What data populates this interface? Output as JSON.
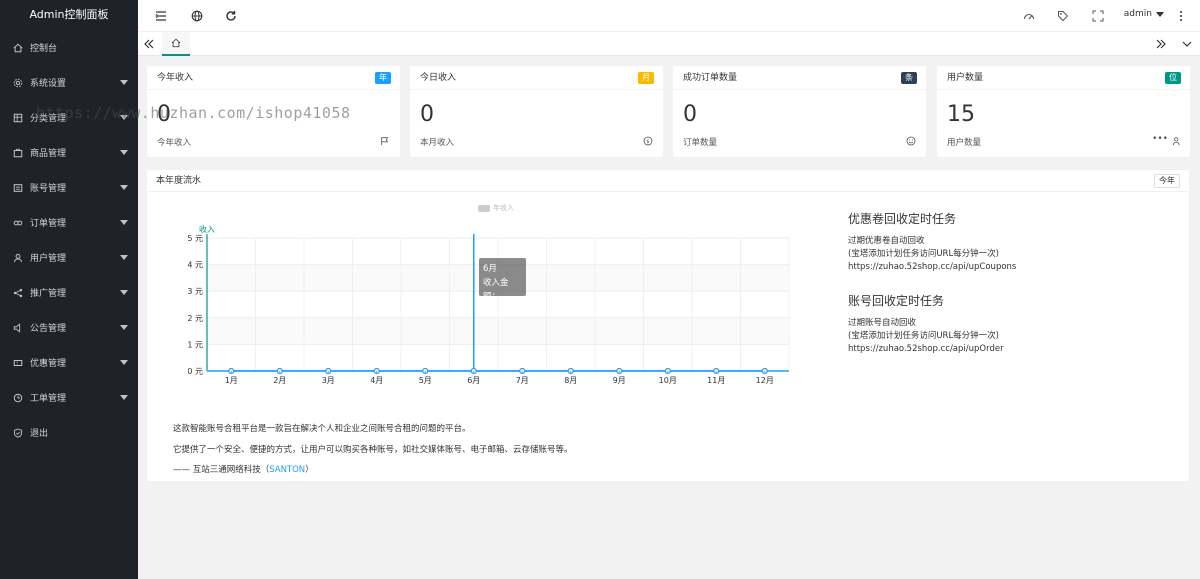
{
  "sidebar": {
    "title": "Admin控制面板",
    "items": [
      {
        "label": "控制台",
        "icon": "home-icon",
        "arrow": false
      },
      {
        "label": "系统设置",
        "icon": "gear-icon",
        "arrow": true
      },
      {
        "label": "分类管理",
        "icon": "category-icon",
        "arrow": true
      },
      {
        "label": "商品管理",
        "icon": "goods-icon",
        "arrow": true
      },
      {
        "label": "账号管理",
        "icon": "account-icon",
        "arrow": true
      },
      {
        "label": "订单管理",
        "icon": "link-icon",
        "arrow": true
      },
      {
        "label": "用户管理",
        "icon": "user-icon",
        "arrow": true
      },
      {
        "label": "推广管理",
        "icon": "share-icon",
        "arrow": true
      },
      {
        "label": "公告管理",
        "icon": "notice-icon",
        "arrow": true
      },
      {
        "label": "优惠管理",
        "icon": "coupon-icon",
        "arrow": true
      },
      {
        "label": "工单管理",
        "icon": "clock-icon",
        "arrow": true
      },
      {
        "label": "退出",
        "icon": "shield-icon",
        "arrow": false
      }
    ]
  },
  "header": {
    "user": "admin"
  },
  "cards": [
    {
      "title": "今年收入",
      "badge": "年",
      "badge_color": "#1e9fff",
      "value": "0",
      "sub": "今年收入",
      "icon": "flag-icon"
    },
    {
      "title": "今日收入",
      "badge": "月",
      "badge_color": "#ffb800",
      "value": "0",
      "sub": "本月收入",
      "icon": "dollar-icon"
    },
    {
      "title": "成功订单数量",
      "badge": "条",
      "badge_color": "#2f4056",
      "value": "0",
      "sub": "订单数量",
      "icon": "smile-icon"
    },
    {
      "title": "用户数量",
      "badge": "位",
      "badge_color": "#009688",
      "value": "15",
      "sub": "用户数量",
      "icon": "users-icon"
    }
  ],
  "panel": {
    "title": "本年度流水",
    "year_button": "今年"
  },
  "chart_data": {
    "type": "line",
    "categories": [
      "1月",
      "2月",
      "3月",
      "4月",
      "5月",
      "6月",
      "7月",
      "8月",
      "9月",
      "10月",
      "11月",
      "12月"
    ],
    "series": [
      {
        "name": "年收入",
        "values": [
          0,
          0,
          0,
          0,
          0,
          0,
          0,
          0,
          0,
          0,
          0,
          0
        ]
      }
    ],
    "ylabel": "收入",
    "yticks": [
      "0 元",
      "1 元",
      "2 元",
      "3 元",
      "4 元",
      "5 元"
    ],
    "ylim": [
      0,
      5
    ],
    "grid": true,
    "legend": "top-center",
    "tooltip": {
      "month": "6月",
      "label": "收入金额："
    },
    "highlight_index": 5,
    "color": "#1e9fff"
  },
  "tasks": [
    {
      "title": "优惠卷回收定时任务",
      "lines": [
        "过期优惠卷自动回收",
        "(宝塔添加计划任务访问URL每分钟一次)",
        "https://zuhao.52shop.cc/api/upCoupons"
      ]
    },
    {
      "title": "账号回收定时任务",
      "lines": [
        "过期账号自动回收",
        "(宝塔添加计划任务访问URL每分钟一次)",
        "https://zuhao.52shop.cc/api/upOrder"
      ]
    }
  ],
  "about": {
    "line1": "这款智能账号合租平台是一款旨在解决个人和企业之间账号合租的问题的平台。",
    "line2": "它提供了一个安全、便捷的方式，让用户可以购买各种账号，如社交媒体账号、电子邮箱、云存储账号等。",
    "line3_prefix": "—— 互站三通网络科技（",
    "line3_link": "SANTON",
    "line3_suffix": "）"
  },
  "watermark": "https://www.huzhan.com/ishop41058"
}
